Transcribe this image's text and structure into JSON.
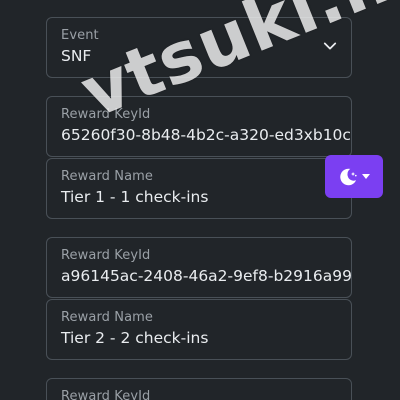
{
  "watermark": "vtsuki.m",
  "event": {
    "label": "Event",
    "value": "SNF"
  },
  "rewards": [
    {
      "key_label": "Reward KeyId",
      "key_value": "65260f30-8b48-4b2c-a320-ed3xb10c",
      "name_label": "Reward Name",
      "name_value": "Tier 1 - 1 check-ins"
    },
    {
      "key_label": "Reward KeyId",
      "key_value": "a96145ac-2408-46a2-9ef8-b2916a99",
      "name_label": "Reward Name",
      "name_value": "Tier 2 - 2 check-ins"
    },
    {
      "key_label": "Reward KeyId"
    }
  ],
  "theme_toggle": {
    "icon": "moon-stars-icon",
    "accent": "#7b3ff2"
  },
  "colors": {
    "background": "#212529",
    "border": "#495057",
    "label": "#9aa0a6",
    "value": "#e9ecef"
  }
}
